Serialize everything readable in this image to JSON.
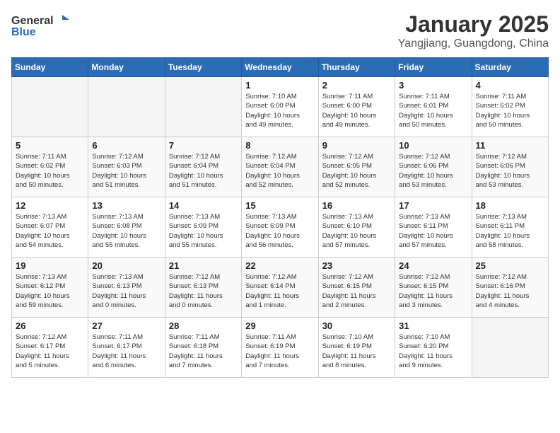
{
  "header": {
    "logo_general": "General",
    "logo_blue": "Blue",
    "month": "January 2025",
    "location": "Yangjiang, Guangdong, China"
  },
  "weekdays": [
    "Sunday",
    "Monday",
    "Tuesday",
    "Wednesday",
    "Thursday",
    "Friday",
    "Saturday"
  ],
  "weeks": [
    [
      {
        "day": "",
        "info": ""
      },
      {
        "day": "",
        "info": ""
      },
      {
        "day": "",
        "info": ""
      },
      {
        "day": "1",
        "info": "Sunrise: 7:10 AM\nSunset: 6:00 PM\nDaylight: 10 hours\nand 49 minutes."
      },
      {
        "day": "2",
        "info": "Sunrise: 7:11 AM\nSunset: 6:00 PM\nDaylight: 10 hours\nand 49 minutes."
      },
      {
        "day": "3",
        "info": "Sunrise: 7:11 AM\nSunset: 6:01 PM\nDaylight: 10 hours\nand 50 minutes."
      },
      {
        "day": "4",
        "info": "Sunrise: 7:11 AM\nSunset: 6:02 PM\nDaylight: 10 hours\nand 50 minutes."
      }
    ],
    [
      {
        "day": "5",
        "info": "Sunrise: 7:11 AM\nSunset: 6:02 PM\nDaylight: 10 hours\nand 50 minutes."
      },
      {
        "day": "6",
        "info": "Sunrise: 7:12 AM\nSunset: 6:03 PM\nDaylight: 10 hours\nand 51 minutes."
      },
      {
        "day": "7",
        "info": "Sunrise: 7:12 AM\nSunset: 6:04 PM\nDaylight: 10 hours\nand 51 minutes."
      },
      {
        "day": "8",
        "info": "Sunrise: 7:12 AM\nSunset: 6:04 PM\nDaylight: 10 hours\nand 52 minutes."
      },
      {
        "day": "9",
        "info": "Sunrise: 7:12 AM\nSunset: 6:05 PM\nDaylight: 10 hours\nand 52 minutes."
      },
      {
        "day": "10",
        "info": "Sunrise: 7:12 AM\nSunset: 6:06 PM\nDaylight: 10 hours\nand 53 minutes."
      },
      {
        "day": "11",
        "info": "Sunrise: 7:12 AM\nSunset: 6:06 PM\nDaylight: 10 hours\nand 53 minutes."
      }
    ],
    [
      {
        "day": "12",
        "info": "Sunrise: 7:13 AM\nSunset: 6:07 PM\nDaylight: 10 hours\nand 54 minutes."
      },
      {
        "day": "13",
        "info": "Sunrise: 7:13 AM\nSunset: 6:08 PM\nDaylight: 10 hours\nand 55 minutes."
      },
      {
        "day": "14",
        "info": "Sunrise: 7:13 AM\nSunset: 6:09 PM\nDaylight: 10 hours\nand 55 minutes."
      },
      {
        "day": "15",
        "info": "Sunrise: 7:13 AM\nSunset: 6:09 PM\nDaylight: 10 hours\nand 56 minutes."
      },
      {
        "day": "16",
        "info": "Sunrise: 7:13 AM\nSunset: 6:10 PM\nDaylight: 10 hours\nand 57 minutes."
      },
      {
        "day": "17",
        "info": "Sunrise: 7:13 AM\nSunset: 6:11 PM\nDaylight: 10 hours\nand 57 minutes."
      },
      {
        "day": "18",
        "info": "Sunrise: 7:13 AM\nSunset: 6:11 PM\nDaylight: 10 hours\nand 58 minutes."
      }
    ],
    [
      {
        "day": "19",
        "info": "Sunrise: 7:13 AM\nSunset: 6:12 PM\nDaylight: 10 hours\nand 59 minutes."
      },
      {
        "day": "20",
        "info": "Sunrise: 7:13 AM\nSunset: 6:13 PM\nDaylight: 11 hours\nand 0 minutes."
      },
      {
        "day": "21",
        "info": "Sunrise: 7:12 AM\nSunset: 6:13 PM\nDaylight: 11 hours\nand 0 minutes."
      },
      {
        "day": "22",
        "info": "Sunrise: 7:12 AM\nSunset: 6:14 PM\nDaylight: 11 hours\nand 1 minute."
      },
      {
        "day": "23",
        "info": "Sunrise: 7:12 AM\nSunset: 6:15 PM\nDaylight: 11 hours\nand 2 minutes."
      },
      {
        "day": "24",
        "info": "Sunrise: 7:12 AM\nSunset: 6:15 PM\nDaylight: 11 hours\nand 3 minutes."
      },
      {
        "day": "25",
        "info": "Sunrise: 7:12 AM\nSunset: 6:16 PM\nDaylight: 11 hours\nand 4 minutes."
      }
    ],
    [
      {
        "day": "26",
        "info": "Sunrise: 7:12 AM\nSunset: 6:17 PM\nDaylight: 11 hours\nand 5 minutes."
      },
      {
        "day": "27",
        "info": "Sunrise: 7:11 AM\nSunset: 6:17 PM\nDaylight: 11 hours\nand 6 minutes."
      },
      {
        "day": "28",
        "info": "Sunrise: 7:11 AM\nSunset: 6:18 PM\nDaylight: 11 hours\nand 7 minutes."
      },
      {
        "day": "29",
        "info": "Sunrise: 7:11 AM\nSunset: 6:19 PM\nDaylight: 11 hours\nand 7 minutes."
      },
      {
        "day": "30",
        "info": "Sunrise: 7:10 AM\nSunset: 6:19 PM\nDaylight: 11 hours\nand 8 minutes."
      },
      {
        "day": "31",
        "info": "Sunrise: 7:10 AM\nSunset: 6:20 PM\nDaylight: 11 hours\nand 9 minutes."
      },
      {
        "day": "",
        "info": ""
      }
    ]
  ]
}
